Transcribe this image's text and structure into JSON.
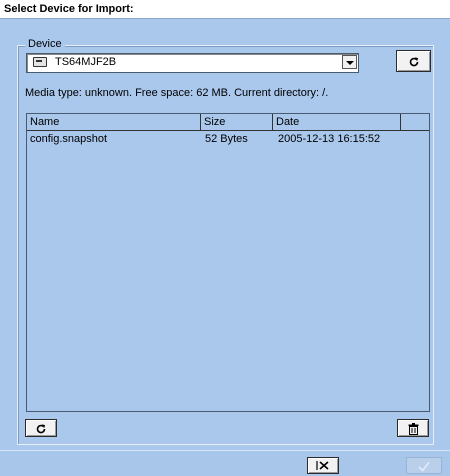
{
  "dialog": {
    "title": "Select Device for Import:"
  },
  "device": {
    "group_label": "Device",
    "selected": "TS64MJF2B",
    "drive_icon": "drive-icon",
    "refresh_icon": "refresh-icon"
  },
  "media_info": "Media type: unknown. Free space: 62 MB. Current directory: /.",
  "file_table": {
    "columns": [
      "Name",
      "Size",
      "Date",
      ""
    ],
    "rows": [
      {
        "name": "config.snapshot",
        "size": "52 Bytes",
        "date": "2005-12-13 16:15:52"
      }
    ]
  },
  "toolbar": {
    "refresh_icon": "refresh-icon",
    "delete_icon": "trash-icon"
  },
  "footer": {
    "cancel_icon": "cancel-x-icon",
    "ok_icon": "checkmark-icon"
  },
  "colors": {
    "background": "#aac7ec",
    "titlebar": "#ffffff",
    "button": "#f2f2f2"
  }
}
